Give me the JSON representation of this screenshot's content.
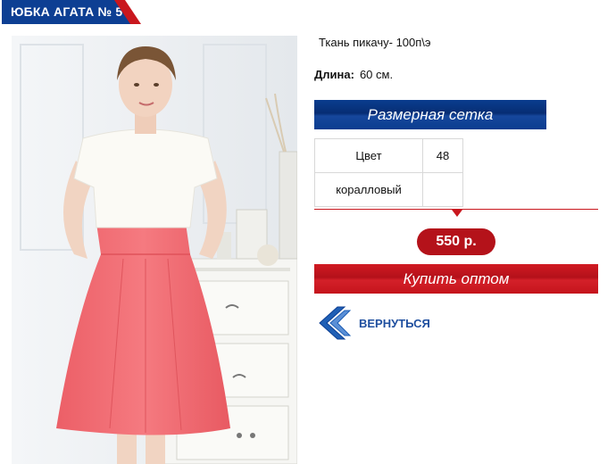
{
  "product": {
    "title": "ЮБКА АГАТА № 5",
    "fabric": "Ткань пикачу- 100п\\э",
    "length_label": "Длина:",
    "length_value": "60 см."
  },
  "size_chart": {
    "button_label": "Размерная сетка",
    "rows": [
      [
        "Цвет",
        "48"
      ],
      [
        "коралловый",
        ""
      ]
    ]
  },
  "price": "550 р.",
  "buy_button_label": "Купить оптом",
  "back_link_label": "ВЕРНУТЬСЯ",
  "colors": {
    "brand_blue": "#0d3f93",
    "accent_red": "#c9171e",
    "skirt_coral": "#f06b72",
    "link_blue": "#1f4f9f"
  },
  "icons": {
    "back": "double-chevron-left-icon"
  }
}
